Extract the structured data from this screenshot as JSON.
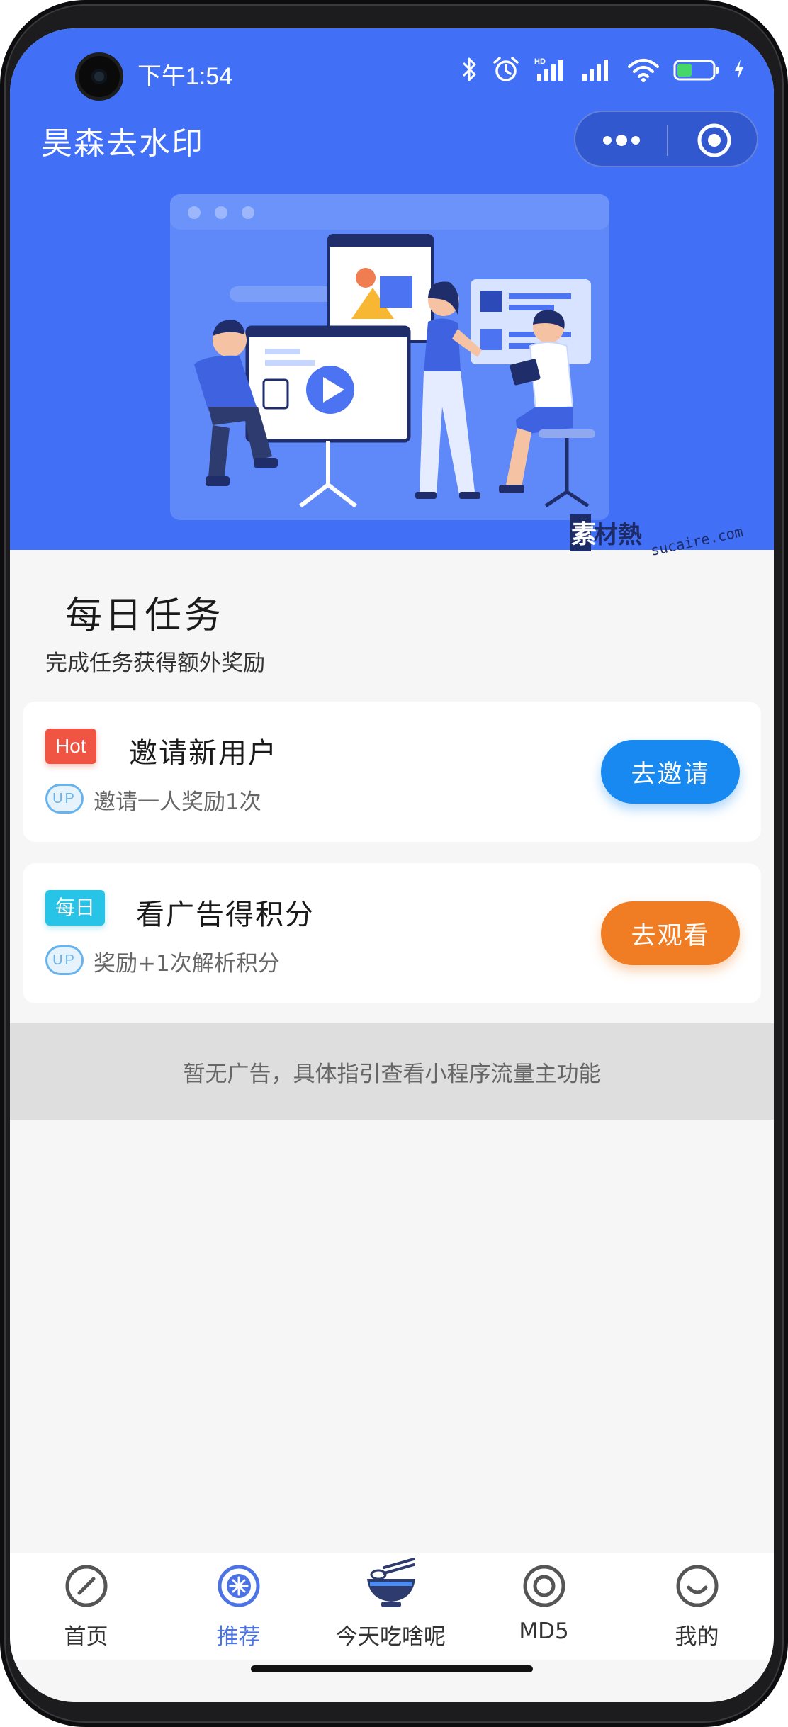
{
  "status_bar": {
    "time": "下午1:54",
    "battery": "35",
    "icons": [
      "bluetooth-icon",
      "alarm-icon",
      "hd-signal-icon",
      "signal-icon",
      "wifi-icon",
      "battery-icon",
      "charging-icon"
    ]
  },
  "nav": {
    "title": "昊森去水印",
    "more_icon": "more-dots-icon",
    "close_icon": "record-target-icon"
  },
  "watermark": {
    "brand": "素材熱",
    "url": "sucaire.com"
  },
  "daily_tasks": {
    "title": "每日任务",
    "subtitle": "完成任务获得额外奖励",
    "tasks": [
      {
        "tag": "Hot",
        "title": "邀请新用户",
        "badge": "UP",
        "desc": "邀请一人奖励1次",
        "button": "去邀请"
      },
      {
        "tag": "每日",
        "title": "看广告得积分",
        "badge": "UP",
        "desc": "奖励+1次解析积分",
        "button": "去观看"
      }
    ]
  },
  "ad_notice": "暂无广告，具体指引查看小程序流量主功能",
  "tabbar": {
    "items": [
      {
        "label": "首页",
        "icon": "compass-icon",
        "active": false
      },
      {
        "label": "推荐",
        "icon": "recommend-icon",
        "active": true
      },
      {
        "label": "今天吃啥呢",
        "icon": "noodle-bowl-icon",
        "active": false
      },
      {
        "label": "MD5",
        "icon": "target-icon",
        "active": false
      },
      {
        "label": "我的",
        "icon": "smile-icon",
        "active": false
      }
    ]
  },
  "colors": {
    "primary_blue": "#4170f6",
    "invite_button": "#1789f0",
    "watch_button": "#f07d23",
    "hot_tag": "#f05443",
    "daily_tag": "#27c4e8",
    "tab_active": "#4b73e6"
  }
}
